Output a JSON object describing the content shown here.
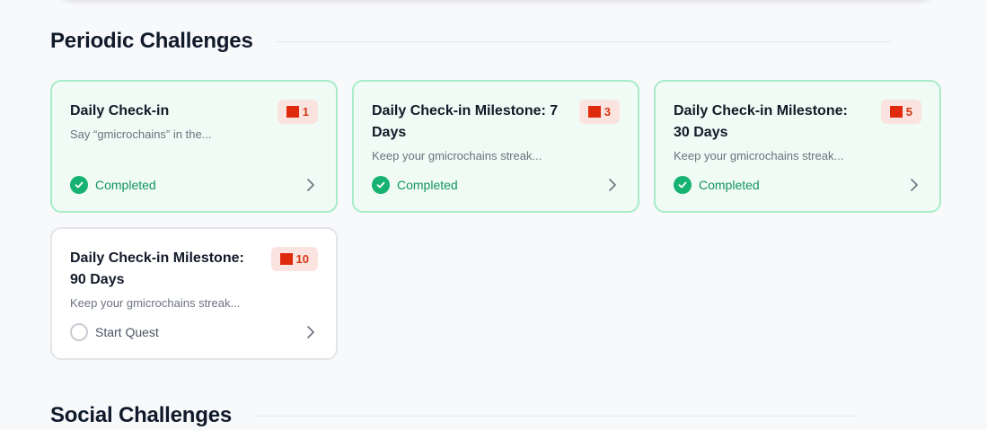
{
  "sections": {
    "periodic": {
      "title": "Periodic Challenges"
    },
    "social": {
      "title": "Social Challenges"
    }
  },
  "colors": {
    "completed_border": "#a9ecc9",
    "completed_bg": "#effbf4",
    "completed_text": "#15945e",
    "check": "#16b271",
    "badge_bg": "#fbe4e0",
    "badge_icon": "#df2a0d",
    "badge_text": "#d63512"
  },
  "cards": [
    {
      "title": "Daily Check-in",
      "description": "Say “gmicrochains” in the...",
      "reward": "1",
      "reward_icon": "red-square-icon",
      "status": "Completed",
      "status_icon": "check-circle-icon"
    },
    {
      "title": "Daily Check-in Milestone: 7 Days",
      "description": "Keep your gmicrochains streak...",
      "reward": "3",
      "reward_icon": "red-square-icon",
      "status": "Completed",
      "status_icon": "check-circle-icon"
    },
    {
      "title": "Daily Check-in Milestone: 30 Days",
      "description": "Keep your gmicrochains streak...",
      "reward": "5",
      "reward_icon": "red-square-icon",
      "status": "Completed",
      "status_icon": "check-circle-icon"
    },
    {
      "title": "Daily Check-in Milestone: 90 Days",
      "description": "Keep your gmicrochains streak...",
      "reward": "10",
      "reward_icon": "red-square-icon",
      "status": "Start Quest",
      "status_icon": "empty-circle-icon"
    }
  ]
}
